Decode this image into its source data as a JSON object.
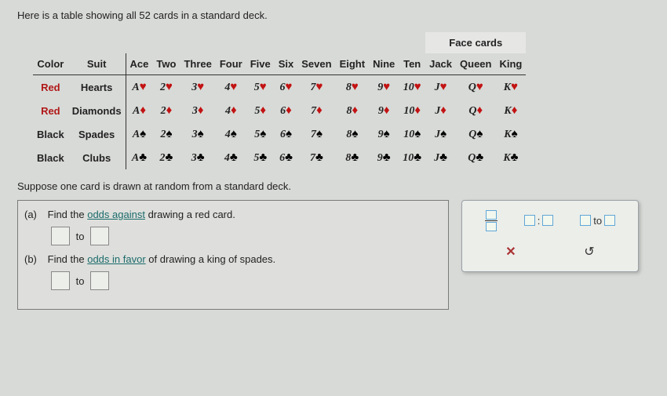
{
  "intro": "Here is a table showing all 52 cards in a standard deck.",
  "headers": {
    "color": "Color",
    "suit": "Suit",
    "face_cards": "Face cards",
    "ranks": [
      "Ace",
      "Two",
      "Three",
      "Four",
      "Five",
      "Six",
      "Seven",
      "Eight",
      "Nine",
      "Ten",
      "Jack",
      "Queen",
      "King"
    ]
  },
  "rank_symbols": [
    "A",
    "2",
    "3",
    "4",
    "5",
    "6",
    "7",
    "8",
    "9",
    "10",
    "J",
    "Q",
    "K"
  ],
  "rows": [
    {
      "color": "Red",
      "suit": "Hearts",
      "sym": "♥",
      "css": "red-suit",
      "color_css": "red"
    },
    {
      "color": "Red",
      "suit": "Diamonds",
      "sym": "♦",
      "css": "red-suit",
      "color_css": "red"
    },
    {
      "color": "Black",
      "suit": "Spades",
      "sym": "♠",
      "css": "black-suit",
      "color_css": ""
    },
    {
      "color": "Black",
      "suit": "Clubs",
      "sym": "♣",
      "css": "black-suit",
      "color_css": ""
    }
  ],
  "prompt": "Suppose one card is drawn at random from a standard deck.",
  "qa": {
    "a_label": "(a)",
    "a_text_pre": "Find the ",
    "a_link": "odds against",
    "a_text_post": " drawing a red card.",
    "b_label": "(b)",
    "b_text_pre": "Find the ",
    "b_link": "odds in favor",
    "b_text_post": " of drawing a king of spades.",
    "to": "to"
  },
  "tools": {
    "ratio_sep": ":",
    "to_word": "to",
    "clear": "✕",
    "reset": "↺"
  }
}
